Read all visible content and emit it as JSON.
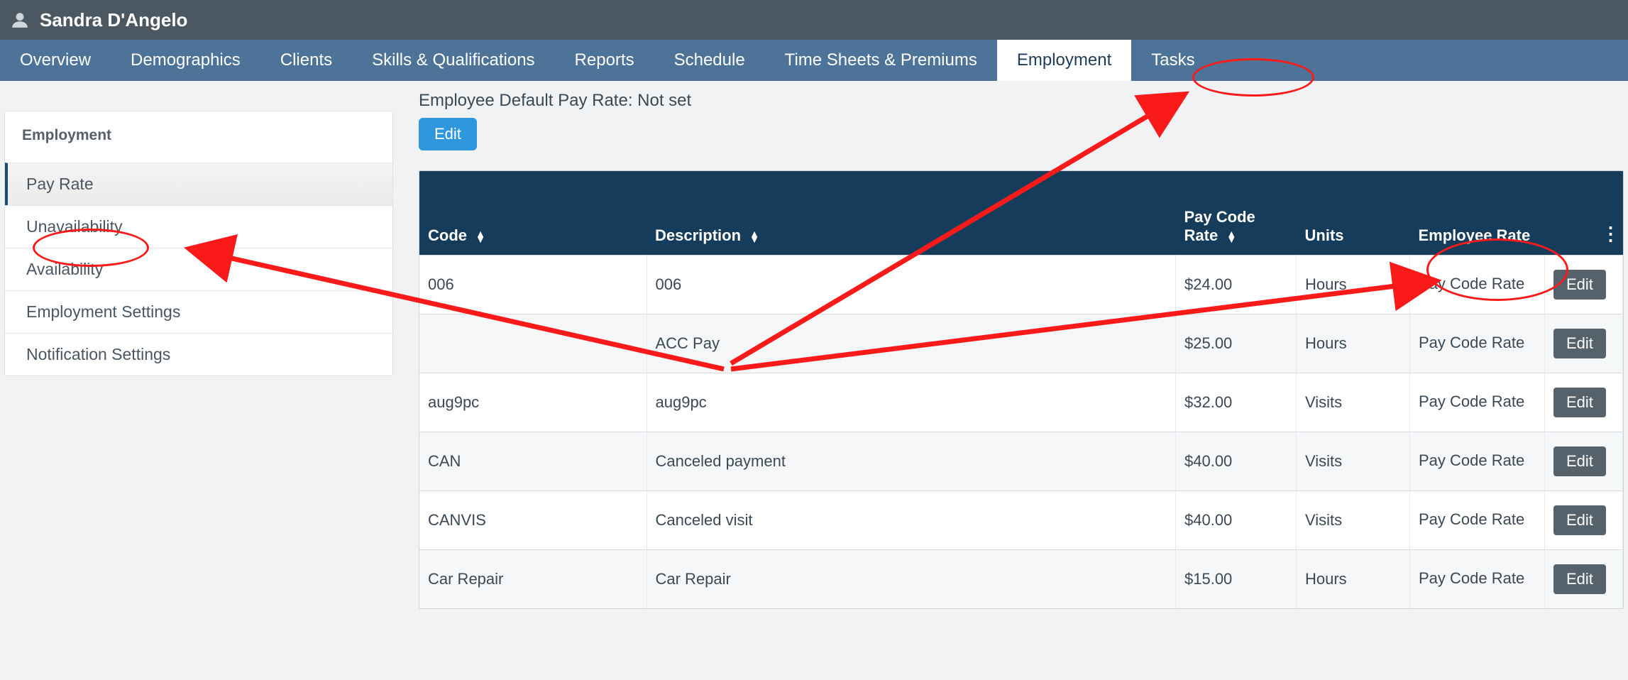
{
  "header": {
    "user_name": "Sandra D'Angelo"
  },
  "tabs": [
    {
      "label": "Overview"
    },
    {
      "label": "Demographics"
    },
    {
      "label": "Clients"
    },
    {
      "label": "Skills & Qualifications"
    },
    {
      "label": "Reports"
    },
    {
      "label": "Schedule"
    },
    {
      "label": "Time Sheets & Premiums"
    },
    {
      "label": "Employment",
      "active": true
    },
    {
      "label": "Tasks"
    }
  ],
  "sidebar": {
    "title": "Employment",
    "items": [
      {
        "label": "Pay Rate",
        "active": true
      },
      {
        "label": "Unavailability"
      },
      {
        "label": "Availability"
      },
      {
        "label": "Employment Settings"
      },
      {
        "label": "Notification Settings"
      }
    ]
  },
  "pay_rate_banner": {
    "text": "Employee Default Pay Rate: Not set",
    "button": "Edit"
  },
  "table": {
    "headers": {
      "code": "Code",
      "description": "Description",
      "pay_code_rate": "Pay Code Rate",
      "units": "Units",
      "employee_rate": "Employee Rate"
    },
    "rows": [
      {
        "code": "006",
        "description": "006",
        "rate": "$24.00",
        "units": "Hours",
        "emp": "Pay Code Rate",
        "edit": "Edit"
      },
      {
        "code": "",
        "description": "ACC Pay",
        "rate": "$25.00",
        "units": "Hours",
        "emp": "Pay Code Rate",
        "edit": "Edit"
      },
      {
        "code": "aug9pc",
        "description": "aug9pc",
        "rate": "$32.00",
        "units": "Visits",
        "emp": "Pay Code Rate",
        "edit": "Edit"
      },
      {
        "code": "CAN",
        "description": "Canceled payment",
        "rate": "$40.00",
        "units": "Visits",
        "emp": "Pay Code Rate",
        "edit": "Edit"
      },
      {
        "code": "CANVIS",
        "description": "Canceled visit",
        "rate": "$40.00",
        "units": "Visits",
        "emp": "Pay Code Rate",
        "edit": "Edit"
      },
      {
        "code": "Car Repair",
        "description": "Car Repair",
        "rate": "$15.00",
        "units": "Hours",
        "emp": "Pay Code Rate",
        "edit": "Edit"
      }
    ]
  }
}
